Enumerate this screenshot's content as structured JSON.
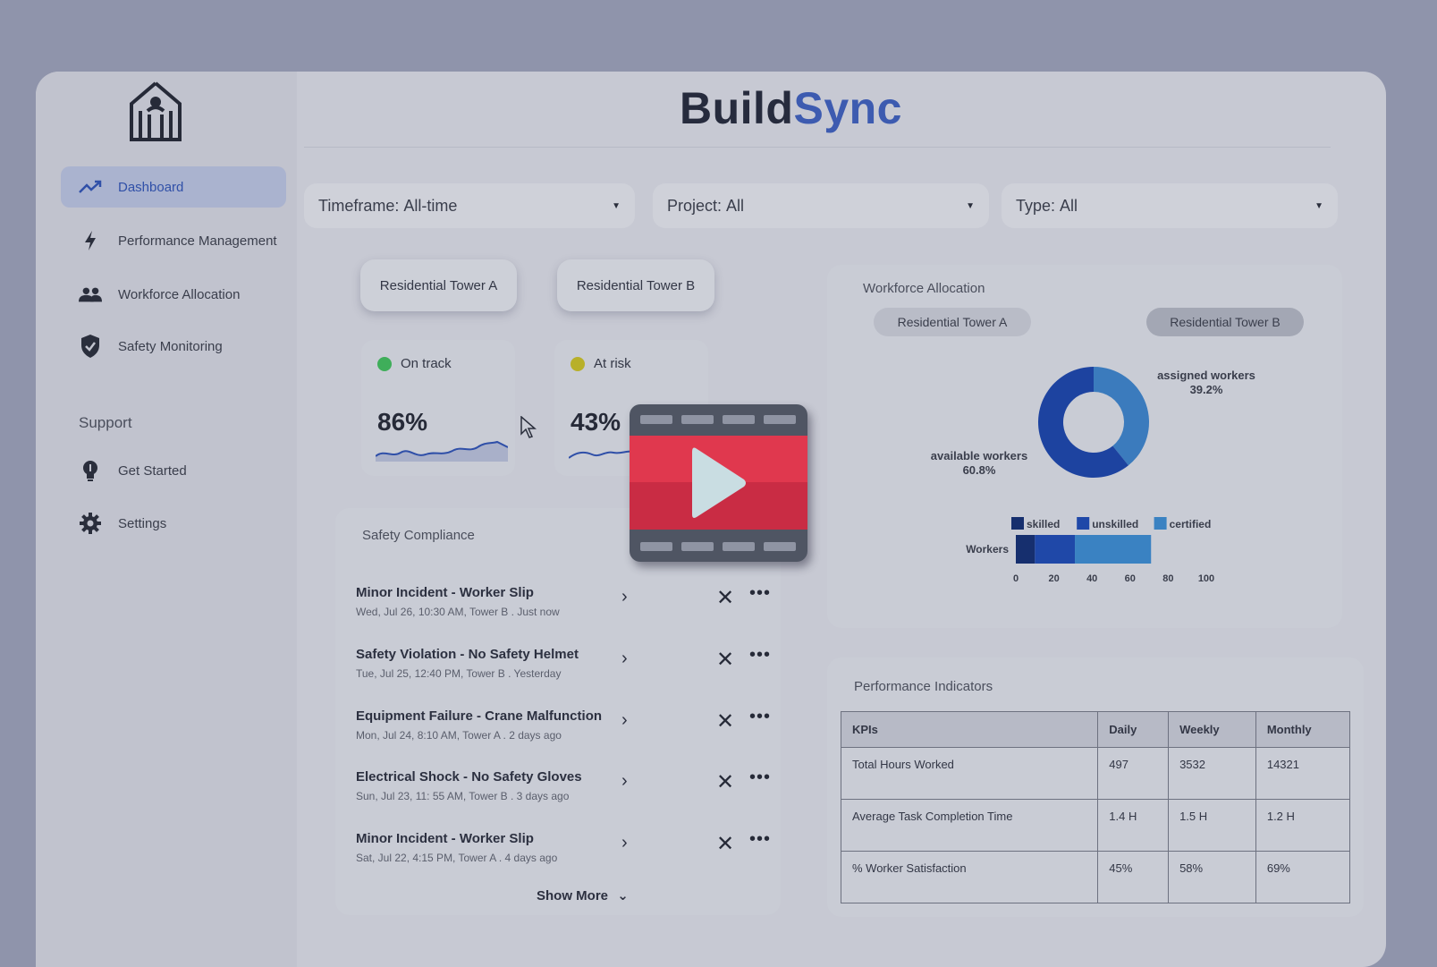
{
  "brand": {
    "part1": "Build",
    "part2": "Sync"
  },
  "sidebar": {
    "items": [
      {
        "label": "Dashboard",
        "icon": "trending-up-icon",
        "active": true
      },
      {
        "label": "Performance Management",
        "icon": "bolt-icon"
      },
      {
        "label": "Workforce Allocation",
        "icon": "people-icon"
      },
      {
        "label": "Safety Monitoring",
        "icon": "shield-check-icon"
      }
    ],
    "support_title": "Support",
    "support_items": [
      {
        "label": "Get Started",
        "icon": "lightbulb-icon"
      },
      {
        "label": "Settings",
        "icon": "gear-icon"
      }
    ]
  },
  "filters": [
    {
      "prefix": "Timeframe:",
      "value": "All-time"
    },
    {
      "prefix": "Project:",
      "value": "All"
    },
    {
      "prefix": "Type:",
      "value": "All"
    }
  ],
  "projects": [
    "Residential Tower A",
    "Residential Tower B"
  ],
  "status_cards": [
    {
      "status": "On track",
      "percent": "86%",
      "dot_color": "#3fae5a"
    },
    {
      "status": "At risk",
      "percent": "43%",
      "dot_color": "#b8b02a"
    }
  ],
  "safety": {
    "title": "Safety Compliance",
    "incidents": [
      {
        "title": "Minor Incident - Worker Slip",
        "meta": "Wed, Jul 26, 10:30 AM, Tower B . Just now"
      },
      {
        "title": "Safety Violation - No Safety Helmet",
        "meta": "Tue, Jul 25, 12:40 PM, Tower B . Yesterday"
      },
      {
        "title": "Equipment Failure - Crane Malfunction",
        "meta": "Mon, Jul 24, 8:10 AM, Tower A . 2 days ago"
      },
      {
        "title": "Electrical Shock -  No Safety Gloves",
        "meta": "Sun, Jul 23, 11: 55 AM, Tower B . 3 days ago"
      },
      {
        "title": "Minor Incident - Worker Slip",
        "meta": "Sat, Jul 22, 4:15 PM, Tower A . 4 days ago"
      }
    ],
    "show_more": "Show More"
  },
  "workforce": {
    "title": "Workforce Allocation",
    "tabs": [
      "Residential Tower A",
      "Residential Tower B"
    ],
    "donut": {
      "assigned_label": "assigned workers",
      "assigned_pct": "39.2%",
      "available_label": "available workers",
      "available_pct": "60.8%"
    },
    "bar": {
      "category": "Workers",
      "legend": [
        "skilled",
        "unskilled",
        "certified"
      ],
      "ticks": [
        "0",
        "20",
        "40",
        "60",
        "80",
        "100"
      ]
    }
  },
  "performance": {
    "title": "Performance Indicators",
    "headers": [
      "KPIs",
      "Daily",
      "Weekly",
      "Monthly"
    ],
    "rows": [
      [
        "Total Hours Worked",
        "497",
        "3532",
        "14321"
      ],
      [
        "Average Task Completion Time",
        "1.4 H",
        "1.5 H",
        "1.2 H"
      ],
      [
        "% Worker Satisfaction",
        "45%",
        "58%",
        "69%"
      ]
    ]
  },
  "chart_data": [
    {
      "type": "pie",
      "title": "",
      "categories": [
        "available workers",
        "assigned workers"
      ],
      "values": [
        60.8,
        39.2
      ],
      "colors": [
        "#1d43a0",
        "#3b7bbd"
      ]
    },
    {
      "type": "bar",
      "orientation": "horizontal",
      "stacked": true,
      "categories": [
        "Workers"
      ],
      "series": [
        {
          "name": "skilled",
          "values": [
            10
          ],
          "color": "#162f6e"
        },
        {
          "name": "unskilled",
          "values": [
            21
          ],
          "color": "#1f48a8"
        },
        {
          "name": "certified",
          "values": [
            40
          ],
          "color": "#3a82c2"
        }
      ],
      "xlim": [
        0,
        100
      ],
      "xticks": [
        0,
        20,
        40,
        60,
        80,
        100
      ],
      "legend_position": "top"
    }
  ]
}
